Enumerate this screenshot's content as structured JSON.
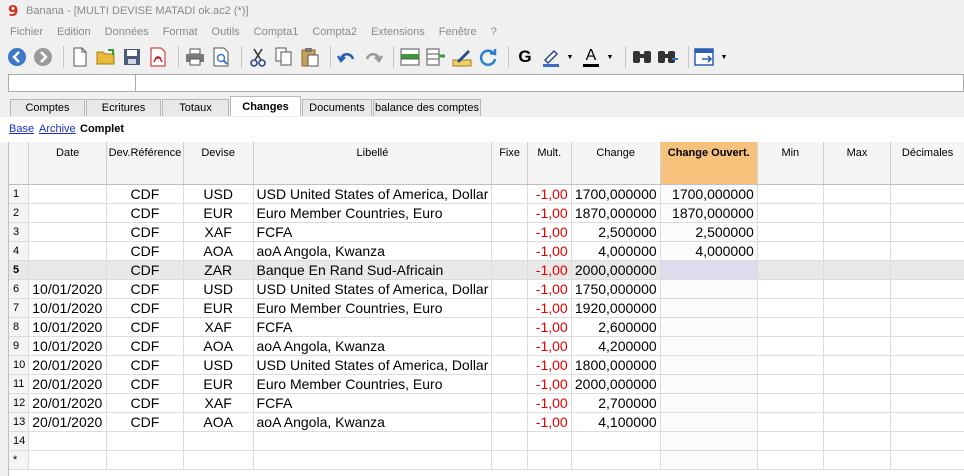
{
  "app": {
    "title": "Banana - [MULTI DEVISE MATADI ok.ac2 (*)]"
  },
  "menu": [
    "Fichier",
    "Edition",
    "Données",
    "Format",
    "Outils",
    "Compta1",
    "Compta2",
    "Extensions",
    "Fenêtre",
    "?"
  ],
  "toolbar": {
    "icons": [
      "back-icon",
      "forward-icon",
      "new-file-icon",
      "open-folder-icon",
      "save-icon",
      "pdf-icon",
      "print-icon",
      "print-preview-icon",
      "cut-icon",
      "copy-icon",
      "paste-icon",
      "undo-icon",
      "redo-icon",
      "insert-rows-icon",
      "delete-rows-icon",
      "edit-icon",
      "refresh-icon",
      "bold-icon",
      "highlight-color-icon",
      "text-color-icon",
      "find-icon",
      "find-replace-icon",
      "export-icon"
    ],
    "bold_label": "G",
    "text_color_label": "A"
  },
  "tabs": [
    "Comptes",
    "Ecritures",
    "Totaux",
    "Changes",
    "Documents",
    "balance des comptes"
  ],
  "active_tab": "Changes",
  "views": [
    "Base",
    "Archive",
    "Complet"
  ],
  "active_view": "Complet",
  "table": {
    "columns": [
      "Date",
      "Dev.Référence",
      "Devise",
      "Libellé",
      "Fixe",
      "Mult.",
      "Change",
      "Change Ouvert.",
      "Min",
      "Max",
      "Décimales"
    ],
    "rows": [
      {
        "n": "1",
        "date": "",
        "ref": "CDF",
        "devise": "USD",
        "libelle": "USD United States of America, Dollar",
        "fixe": "",
        "mult": "-1,00",
        "change": "1700,000000",
        "ouvert": "1700,000000",
        "min": "",
        "max": "",
        "dec": ""
      },
      {
        "n": "2",
        "date": "",
        "ref": "CDF",
        "devise": "EUR",
        "libelle": "Euro Member Countries, Euro",
        "fixe": "",
        "mult": "-1,00",
        "change": "1870,000000",
        "ouvert": "1870,000000",
        "min": "",
        "max": "",
        "dec": ""
      },
      {
        "n": "3",
        "date": "",
        "ref": "CDF",
        "devise": "XAF",
        "libelle": "FCFA",
        "fixe": "",
        "mult": "-1,00",
        "change": "2,500000",
        "ouvert": "2,500000",
        "min": "",
        "max": "",
        "dec": ""
      },
      {
        "n": "4",
        "date": "",
        "ref": "CDF",
        "devise": "AOA",
        "libelle": "aoA Angola, Kwanza",
        "fixe": "",
        "mult": "-1,00",
        "change": "4,000000",
        "ouvert": "4,000000",
        "min": "",
        "max": "",
        "dec": ""
      },
      {
        "n": "5",
        "date": "",
        "ref": "CDF",
        "devise": "ZAR",
        "libelle": "Banque En Rand Sud-Africain",
        "fixe": "",
        "mult": "-1,00",
        "change": "2000,000000",
        "ouvert": "",
        "min": "",
        "max": "",
        "dec": ""
      },
      {
        "n": "6",
        "date": "10/01/2020",
        "ref": "CDF",
        "devise": "USD",
        "libelle": "USD United States of America, Dollar",
        "fixe": "",
        "mult": "-1,00",
        "change": "1750,000000",
        "ouvert": "",
        "min": "",
        "max": "",
        "dec": ""
      },
      {
        "n": "7",
        "date": "10/01/2020",
        "ref": "CDF",
        "devise": "EUR",
        "libelle": "Euro Member Countries, Euro",
        "fixe": "",
        "mult": "-1,00",
        "change": "1920,000000",
        "ouvert": "",
        "min": "",
        "max": "",
        "dec": ""
      },
      {
        "n": "8",
        "date": "10/01/2020",
        "ref": "CDF",
        "devise": "XAF",
        "libelle": "FCFA",
        "fixe": "",
        "mult": "-1,00",
        "change": "2,600000",
        "ouvert": "",
        "min": "",
        "max": "",
        "dec": ""
      },
      {
        "n": "9",
        "date": "10/01/2020",
        "ref": "CDF",
        "devise": "AOA",
        "libelle": "aoA Angola, Kwanza",
        "fixe": "",
        "mult": "-1,00",
        "change": "4,200000",
        "ouvert": "",
        "min": "",
        "max": "",
        "dec": ""
      },
      {
        "n": "10",
        "date": "20/01/2020",
        "ref": "CDF",
        "devise": "USD",
        "libelle": "USD United States of America, Dollar",
        "fixe": "",
        "mult": "-1,00",
        "change": "1800,000000",
        "ouvert": "",
        "min": "",
        "max": "",
        "dec": ""
      },
      {
        "n": "11",
        "date": "20/01/2020",
        "ref": "CDF",
        "devise": "EUR",
        "libelle": "Euro Member Countries, Euro",
        "fixe": "",
        "mult": "-1,00",
        "change": "2000,000000",
        "ouvert": "",
        "min": "",
        "max": "",
        "dec": ""
      },
      {
        "n": "12",
        "date": "20/01/2020",
        "ref": "CDF",
        "devise": "XAF",
        "libelle": "FCFA",
        "fixe": "",
        "mult": "-1,00",
        "change": "2,700000",
        "ouvert": "",
        "min": "",
        "max": "",
        "dec": ""
      },
      {
        "n": "13",
        "date": "20/01/2020",
        "ref": "CDF",
        "devise": "AOA",
        "libelle": "aoA Angola, Kwanza",
        "fixe": "",
        "mult": "-1,00",
        "change": "4,100000",
        "ouvert": "",
        "min": "",
        "max": "",
        "dec": ""
      },
      {
        "n": "14",
        "date": "",
        "ref": "",
        "devise": "",
        "libelle": "",
        "fixe": "",
        "mult": "",
        "change": "",
        "ouvert": "",
        "min": "",
        "max": "",
        "dec": ""
      },
      {
        "n": "*",
        "date": "",
        "ref": "",
        "devise": "",
        "libelle": "",
        "fixe": "",
        "mult": "",
        "change": "",
        "ouvert": "",
        "min": "",
        "max": "",
        "dec": ""
      }
    ]
  },
  "colors": {
    "highlight_header": "#f7c37c",
    "negative": "#e00000",
    "link": "#1a2cc8"
  }
}
